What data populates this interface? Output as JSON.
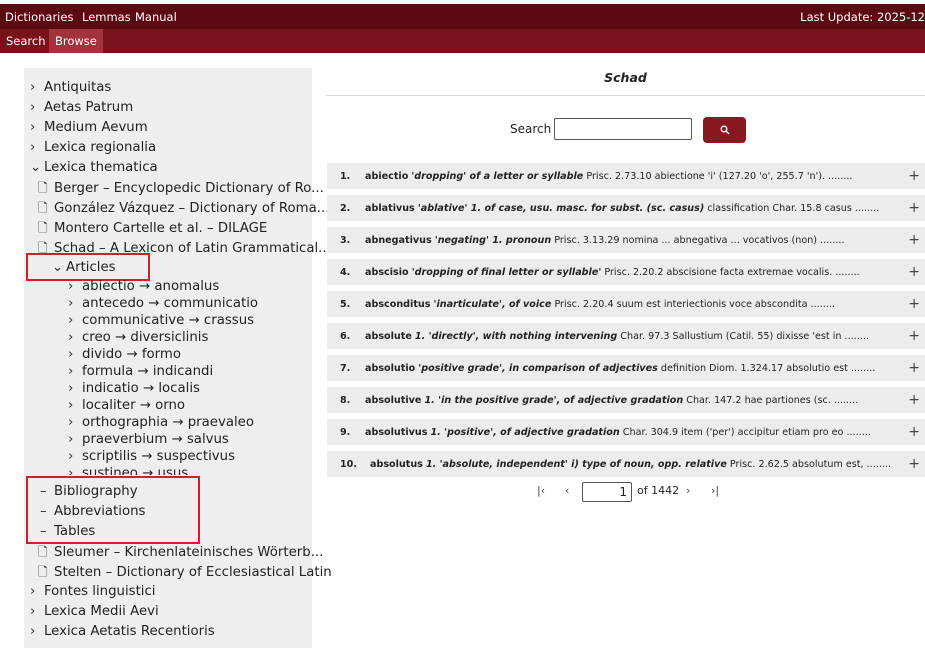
{
  "topnav": {
    "items": [
      "Dictionaries",
      "Lemmas",
      "Manual"
    ],
    "last_update": "Last Update: 2025-12"
  },
  "subnav": {
    "items": [
      "Search",
      "Browse"
    ],
    "active": "Browse"
  },
  "sidebar": {
    "top_items": [
      "Antiquitas",
      "Aetas Patrum",
      "Medium Aevum",
      "Lexica regionalia"
    ],
    "thematica": {
      "label": "Lexica thematica",
      "dicts": [
        "Berger – Encyclopedic Dictionary of Ro...",
        "González Vázquez – Dictionary of Roma...",
        "Montero Cartelle et al. – DILAGE",
        "Schad – A Lexicon of Latin Grammatical..."
      ],
      "articles_label": "Articles",
      "ranges": [
        "abiectio → anomalus",
        "antecedo → communicatio",
        "communicative → crassus",
        "creo → diversiclinis",
        "divido → formo",
        "formula → indicandi",
        "indicatio → localis",
        "localiter → orno",
        "orthographia → praevaleo",
        "praeverbium → salvus",
        "scriptilis → suspectivus",
        "sustineo → usus"
      ],
      "extras": [
        "Bibliography",
        "Abbreviations",
        "Tables"
      ],
      "more_dicts": [
        "Sleumer – Kirchenlateinisches Wörterb...",
        "Stelten – Dictionary of Ecclesiastical Latin"
      ]
    },
    "bottom_items": [
      "Fontes linguistici",
      "Lexica Medii Aevi",
      "Lexica Aetatis Recentioris"
    ]
  },
  "main": {
    "title": "Schad",
    "search_label": "Search",
    "search_value": "",
    "results": [
      {
        "num": "1.",
        "lemma": "abiectio",
        "gloss": "'dropping' of a letter or syllable",
        "rest": " Prisc. 2.73.10 abiectione 'i' (127.20 'o', 255.7 'n'). ........"
      },
      {
        "num": "2.",
        "lemma": "ablativus",
        "gloss": "'ablative' 1. of case, usu. masc. for subst. (sc. casus)",
        "rest": " classification Char. 15.8 casus ........"
      },
      {
        "num": "3.",
        "lemma": "abnegativus",
        "gloss": "'negating' 1. pronoun",
        "rest": " Prisc. 3.13.29 nomina ... abnegativa ... vocativos (non) ........"
      },
      {
        "num": "4.",
        "lemma": "abscisio",
        "gloss": "'dropping of final letter or syllable'",
        "rest": " Prisc. 2.20.2 abscisione facta extremae vocalis. ........"
      },
      {
        "num": "5.",
        "lemma": "absconditus",
        "gloss": "'inarticulate', of voice",
        "rest": " Prisc. 2.20.4 suum est interiectionis voce abscondita ........"
      },
      {
        "num": "6.",
        "lemma": "absolute",
        "gloss": "1. 'directly', with nothing intervening",
        "rest": " Char. 97.3 Sallustium (Catil. 55) dixisse 'est in ........"
      },
      {
        "num": "7.",
        "lemma": "absolutio",
        "gloss": "'positive grade', in comparison of adjectives",
        "rest": " definition Diom. 1.324.17 absolutio est ........"
      },
      {
        "num": "8.",
        "lemma": "absolutive",
        "gloss": "1. 'in the positive grade', of adjective gradation",
        "rest": " Char. 147.2 hae partiones (sc. ........"
      },
      {
        "num": "9.",
        "lemma": "absolutivus",
        "gloss": "1. 'positive', of adjective gradation",
        "rest": " Char. 304.9 item ('per') accipitur etiam pro eo ........"
      },
      {
        "num": "10.",
        "lemma": "absolutus",
        "gloss": "1. 'absolute, independent' i) type of noun, opp. relative",
        "rest": " Prisc. 2.62.5 absolutum est, ........"
      }
    ],
    "pagination": {
      "first": "|‹",
      "prev": "‹",
      "page": "1",
      "of_total": "of 1442",
      "next": "›",
      "last": "›|"
    }
  }
}
